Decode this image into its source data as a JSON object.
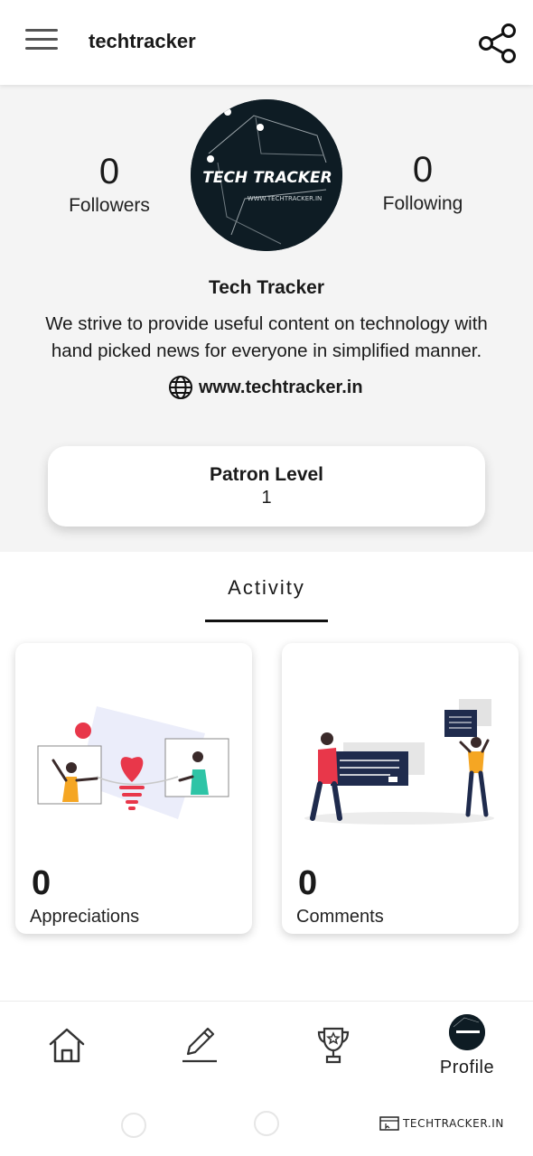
{
  "header": {
    "title": "techtracker",
    "menu_icon": "hamburger-menu-icon",
    "share_icon": "share-icon"
  },
  "profile": {
    "followers_count": "0",
    "followers_label": "Followers",
    "following_count": "0",
    "following_label": "Following",
    "avatar_text": "TECH TRACKER",
    "avatar_subtext": "WWW.TECHTRACKER.IN",
    "name": "Tech Tracker",
    "bio": "We strive to provide useful content on technology with hand picked news for everyone in simplified manner.",
    "website": "www.techtracker.in",
    "website_icon": "globe-icon"
  },
  "patron": {
    "title": "Patron Level",
    "value": "1"
  },
  "activity": {
    "tab_label": "Activity",
    "cards": [
      {
        "count": "0",
        "label": "Appreciations",
        "illustration": "appreciation-illustration"
      },
      {
        "count": "0",
        "label": "Comments",
        "illustration": "comments-illustration"
      }
    ]
  },
  "bottom_nav": {
    "items": [
      {
        "icon": "home-icon"
      },
      {
        "icon": "pencil-icon"
      },
      {
        "icon": "trophy-icon"
      },
      {
        "icon": "avatar",
        "label": "Profile"
      }
    ]
  },
  "watermark": {
    "text": "TECHTRACKER.IN"
  },
  "colors": {
    "accent_red": "#e8374a",
    "navy": "#1f2b4d",
    "yellow": "#f5a623",
    "avatar_bg": "#0e1c24"
  }
}
